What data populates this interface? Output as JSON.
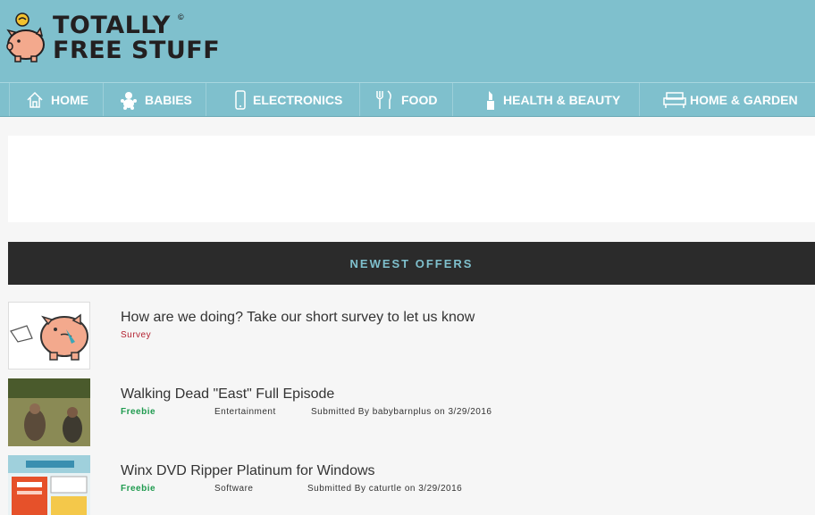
{
  "brand": {
    "line1": "TOTALLY",
    "line2": "FREE STUFF",
    "copyright": "©"
  },
  "colors": {
    "header": "#7fc0cd",
    "offers_bar": "#2b2b2b",
    "survey_tag": "#b3202f",
    "freebie_tag": "#1f9b4f"
  },
  "nav": [
    {
      "label": "HOME",
      "icon": "home-icon"
    },
    {
      "label": "BABIES",
      "icon": "baby-icon"
    },
    {
      "label": "ELECTRONICS",
      "icon": "phone-icon"
    },
    {
      "label": "FOOD",
      "icon": "fork-knife-icon"
    },
    {
      "label": "HEALTH & BEAUTY",
      "icon": "lipstick-icon"
    },
    {
      "label": "HOME & GARDEN",
      "icon": "sofa-icon"
    }
  ],
  "offers": {
    "title": "NEWEST OFFERS",
    "items": [
      {
        "title": "How are we doing? Take our short survey to let us know",
        "tag": "Survey"
      },
      {
        "title": "Walking Dead \"East\" Full Episode",
        "tag": "Freebie",
        "category": "Entertainment",
        "submitted": "Submitted By babybarnplus on 3/29/2016"
      },
      {
        "title": "Winx DVD Ripper Platinum for Windows",
        "tag": "Freebie",
        "category": "Software",
        "submitted": "Submitted By caturtle on 3/29/2016"
      }
    ]
  }
}
